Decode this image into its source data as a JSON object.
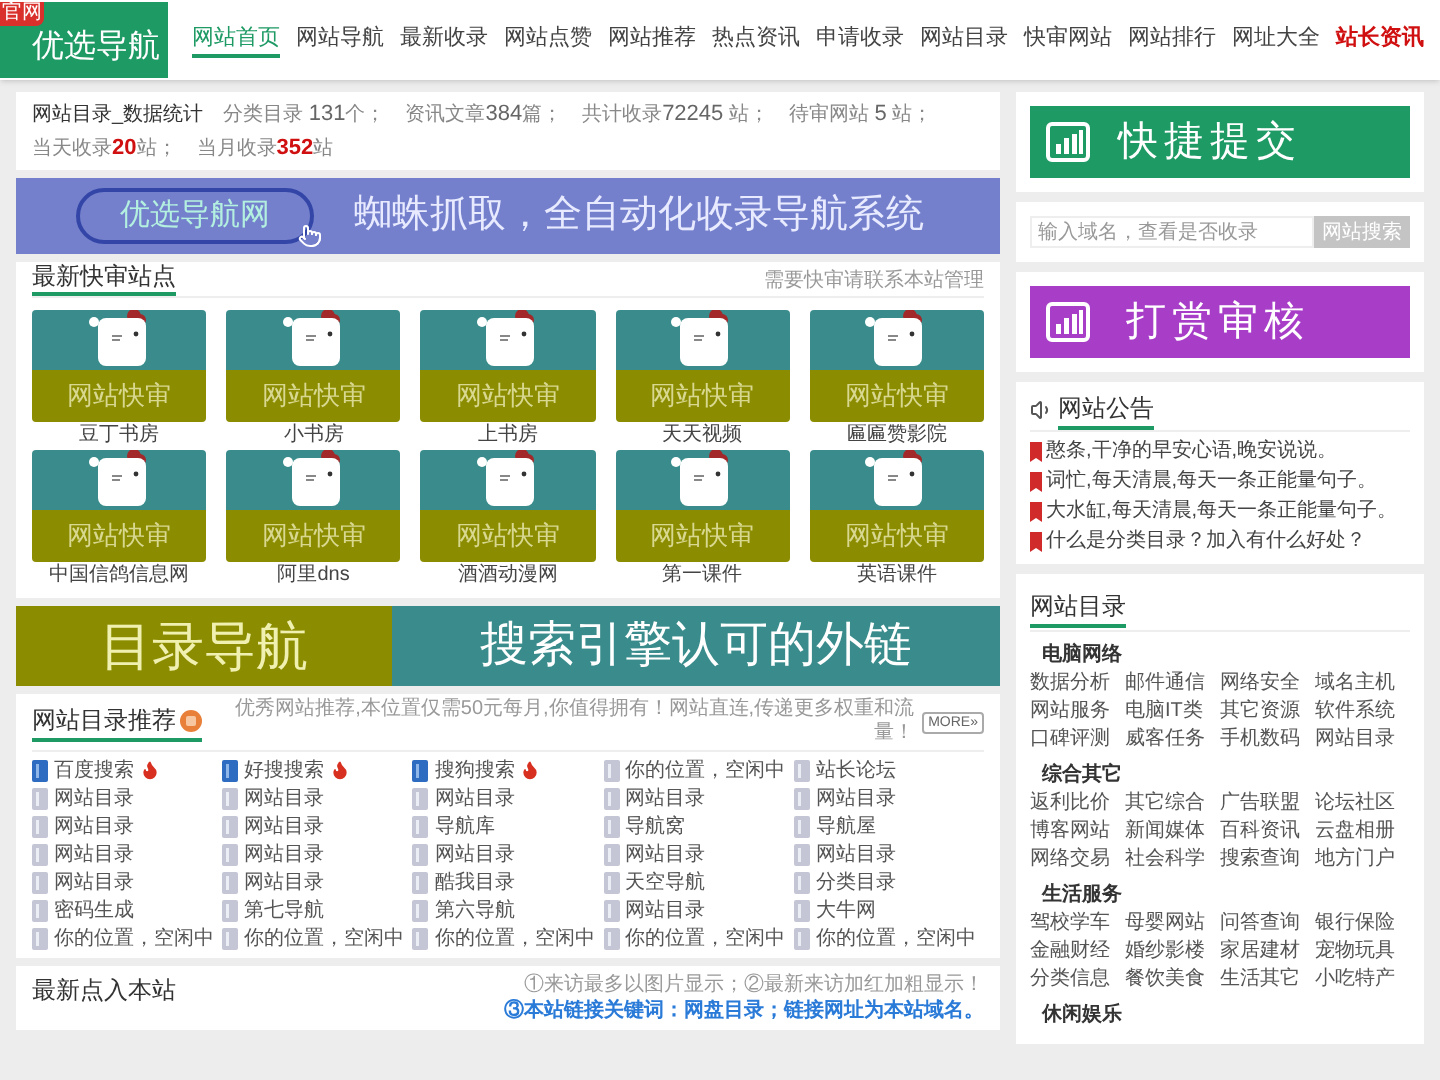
{
  "logo": {
    "ribbon": "官网",
    "title": "优选导航"
  },
  "nav": [
    {
      "label": "网站首页",
      "selected": true,
      "highlight": false
    },
    {
      "label": "网站导航",
      "selected": false,
      "highlight": false
    },
    {
      "label": "最新收录",
      "selected": false,
      "highlight": false
    },
    {
      "label": "网站点赞",
      "selected": false,
      "highlight": false
    },
    {
      "label": "网站推荐",
      "selected": false,
      "highlight": false
    },
    {
      "label": "热点资讯",
      "selected": false,
      "highlight": false
    },
    {
      "label": "申请收录",
      "selected": false,
      "highlight": false
    },
    {
      "label": "网站目录",
      "selected": false,
      "highlight": false
    },
    {
      "label": "快审网站",
      "selected": false,
      "highlight": false
    },
    {
      "label": "网站排行",
      "selected": false,
      "highlight": false
    },
    {
      "label": "网址大全",
      "selected": false,
      "highlight": false
    },
    {
      "label": "站长资讯",
      "selected": false,
      "highlight": true
    }
  ],
  "stats": {
    "title": "网站目录_数据统计",
    "items": [
      {
        "label": "分类目录 ",
        "value": "131",
        "unit": "个；",
        "highlight": false
      },
      {
        "label": "资讯文章",
        "value": "384",
        "unit": "篇；",
        "highlight": false
      },
      {
        "label": "共计收录",
        "value": "72245",
        "unit": " 站；",
        "highlight": false
      },
      {
        "label": "待审网站 ",
        "value": "5",
        "unit": " 站；",
        "highlight": false
      },
      {
        "label": "当天收录",
        "value": "20",
        "unit": "站；",
        "highlight": true
      },
      {
        "label": "当月收录",
        "value": "352",
        "unit": "站",
        "highlight": true
      }
    ]
  },
  "promo_banner": {
    "pill": "优选导航网",
    "text": "蜘蛛抓取，全自动化收录导航系统"
  },
  "quick_review": {
    "title": "最新快审站点",
    "note": "需要快审请联系本站管理",
    "sites": [
      {
        "badge": "网站快审",
        "name": "豆丁书房"
      },
      {
        "badge": "网站快审",
        "name": "小书房"
      },
      {
        "badge": "网站快审",
        "name": "上书房"
      },
      {
        "badge": "网站快审",
        "name": "天天视频"
      },
      {
        "badge": "网站快审",
        "name": "匾匾赞影院"
      },
      {
        "badge": "网站快审",
        "name": "中国信鸽信息网"
      },
      {
        "badge": "网站快审",
        "name": "阿里dns"
      },
      {
        "badge": "网站快审",
        "name": "酒酒动漫网"
      },
      {
        "badge": "网站快审",
        "name": "第一课件"
      },
      {
        "badge": "网站快审",
        "name": "英语课件"
      }
    ]
  },
  "ad_banner": {
    "left": "目录导航",
    "right": "搜索引擎认可的外链"
  },
  "recommend": {
    "title": "网站目录推荐",
    "note": "优秀网站推荐,本位置仅需50元每月,你值得拥有！网站直连,传递更多权重和流量！",
    "more": "MORE»",
    "items": [
      {
        "label": "百度搜索",
        "hot": true
      },
      {
        "label": "好搜搜索",
        "hot": true
      },
      {
        "label": "搜狗搜索",
        "hot": true
      },
      {
        "label": "你的位置，空闲中",
        "hot": false
      },
      {
        "label": "站长论坛",
        "hot": false
      },
      {
        "label": "网站目录",
        "hot": false
      },
      {
        "label": "网站目录",
        "hot": false
      },
      {
        "label": "网站目录",
        "hot": false
      },
      {
        "label": "网站目录",
        "hot": false
      },
      {
        "label": "网站目录",
        "hot": false
      },
      {
        "label": "网站目录",
        "hot": false
      },
      {
        "label": "网站目录",
        "hot": false
      },
      {
        "label": "导航库",
        "hot": false
      },
      {
        "label": "导航窝",
        "hot": false
      },
      {
        "label": "导航屋",
        "hot": false
      },
      {
        "label": "网站目录",
        "hot": false
      },
      {
        "label": "网站目录",
        "hot": false
      },
      {
        "label": "网站目录",
        "hot": false
      },
      {
        "label": "网站目录",
        "hot": false
      },
      {
        "label": "网站目录",
        "hot": false
      },
      {
        "label": "网站目录",
        "hot": false
      },
      {
        "label": "网站目录",
        "hot": false
      },
      {
        "label": "酷我目录",
        "hot": false
      },
      {
        "label": "天空导航",
        "hot": false
      },
      {
        "label": "分类目录",
        "hot": false
      },
      {
        "label": "密码生成",
        "hot": false
      },
      {
        "label": "第七导航",
        "hot": false
      },
      {
        "label": "第六导航",
        "hot": false
      },
      {
        "label": "网站目录",
        "hot": false
      },
      {
        "label": "大牛网",
        "hot": false
      },
      {
        "label": "你的位置，空闲中",
        "hot": false
      },
      {
        "label": "你的位置，空闲中",
        "hot": false
      },
      {
        "label": "你的位置，空闲中",
        "hot": false
      },
      {
        "label": "你的位置，空闲中",
        "hot": false
      },
      {
        "label": "你的位置，空闲中",
        "hot": false
      }
    ]
  },
  "recent_visits": {
    "title": "最新点入本站",
    "notice": "①来访最多以图片显示；②最新来访加红加粗显示！",
    "notice_highlight": "③本站链接关键词：网盘目录；链接网址为本站域名。"
  },
  "sidebar": {
    "quick_submit": "快捷提交",
    "search": {
      "placeholder": "输入域名，查看是否收录",
      "button": "网站搜索"
    },
    "reward": "打赏审核",
    "announcements": {
      "title": "网站公告",
      "items": [
        "憨条,干净的早安心语,晚安说说。",
        "词忙,每天清晨,每天一条正能量句子。",
        "大水缸,每天清晨,每天一条正能量句子。",
        "什么是分类目录？加入有什么好处？"
      ]
    },
    "directory": {
      "title": "网站目录",
      "groups": [
        {
          "name": "电脑网络",
          "links": [
            "数据分析",
            "邮件通信",
            "网络安全",
            "域名主机",
            "网站服务",
            "电脑IT类",
            "其它资源",
            "软件系统",
            "口碑评测",
            "威客任务",
            "手机数码",
            "网站目录"
          ]
        },
        {
          "name": "综合其它",
          "links": [
            "返利比价",
            "其它综合",
            "广告联盟",
            "论坛社区",
            "博客网站",
            "新闻媒体",
            "百科资讯",
            "云盘相册",
            "网络交易",
            "社会科学",
            "搜索查询",
            "地方门户"
          ]
        },
        {
          "name": "生活服务",
          "links": [
            "驾校学车",
            "母婴网站",
            "问答查询",
            "银行保险",
            "金融财经",
            "婚纱影楼",
            "家居建材",
            "宠物玩具",
            "分类信息",
            "餐饮美食",
            "生活其它",
            "小吃特产"
          ]
        },
        {
          "name": "休闲娱乐"
        }
      ]
    }
  }
}
